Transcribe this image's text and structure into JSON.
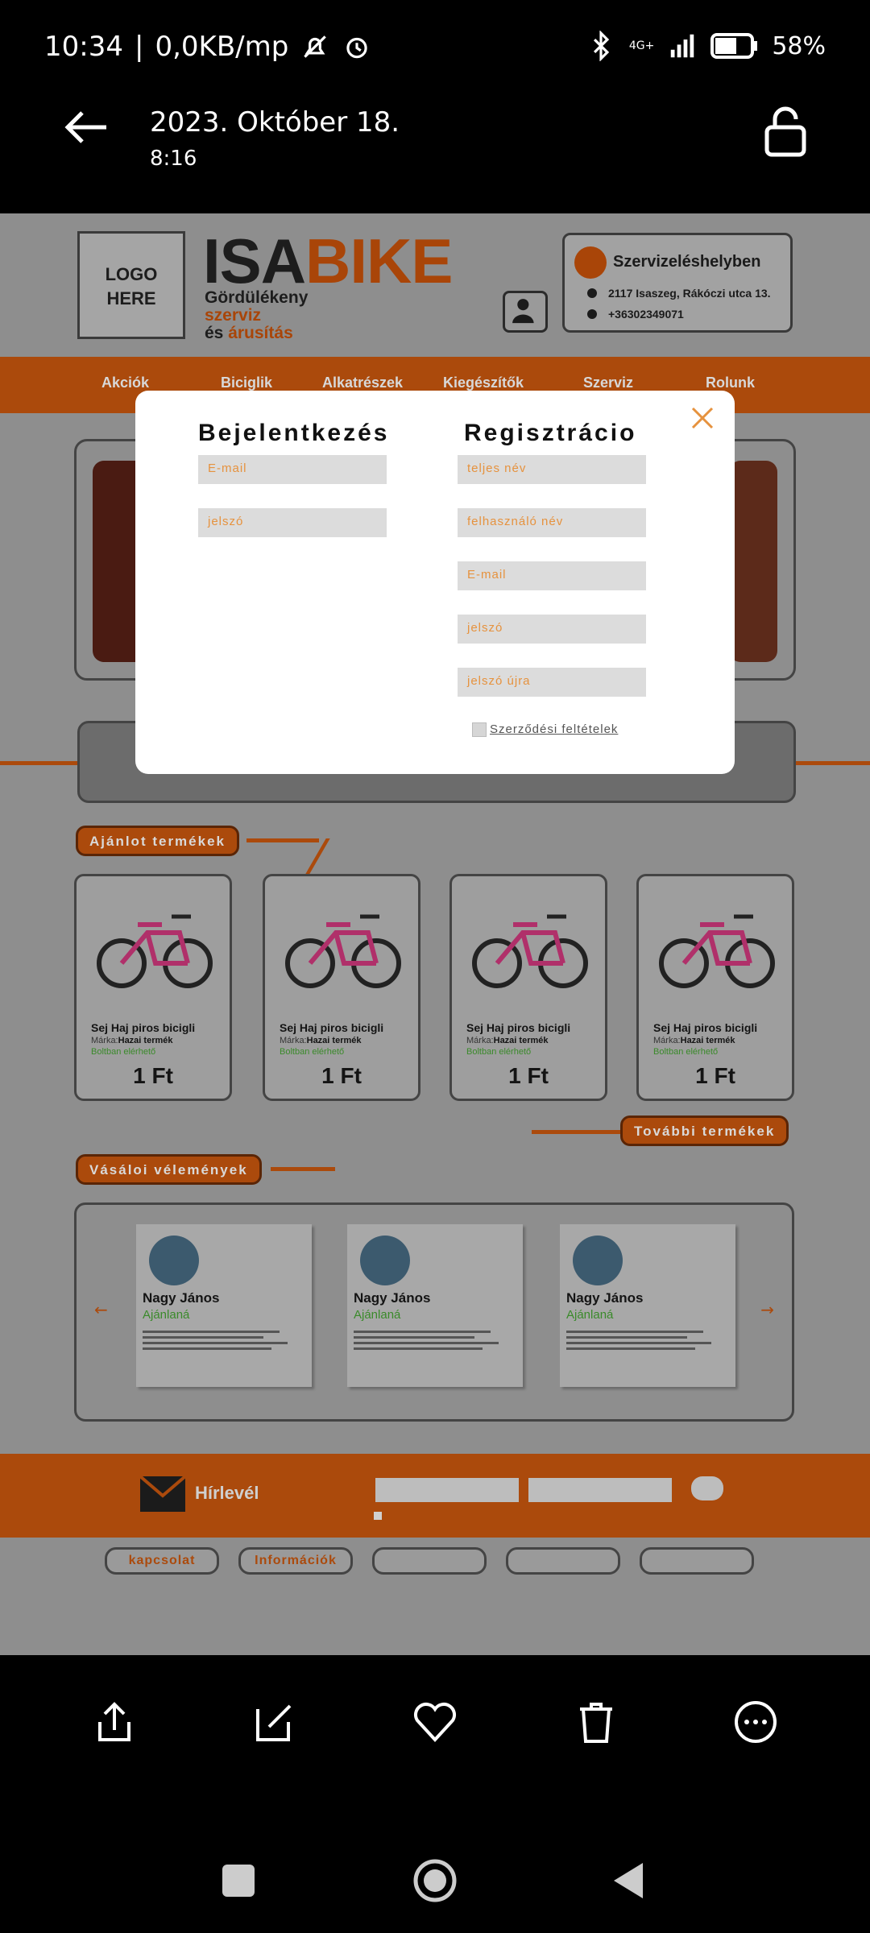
{
  "status_bar": {
    "time": "10:34",
    "network_speed": "0,0KB/mp",
    "network_type": "4G+",
    "battery": "58%"
  },
  "viewer": {
    "date": "2023. Október 18.",
    "time": "8:16"
  },
  "photo": {
    "logo_text_1": "LOGO",
    "logo_text_2": "HERE",
    "brand_dark": "ISA",
    "brand_orange": "BIKE",
    "tagline_1": "Gördülékeny",
    "tagline_2": "szerviz",
    "tagline_3_prefix": "és ",
    "tagline_3_suffix": "árusítás",
    "service_title": "Szervizeléshelyben",
    "service_address": "2117 Isaszeg, Rákóczi utca 13.",
    "service_phone": "+36302349071",
    "nav_items": [
      "Akciók",
      "Biciglik",
      "Alkatrészek",
      "Kiegészítők",
      "Szerviz",
      "Rolunk"
    ],
    "featured_label": "Ajánlot termékek",
    "more_label": "További termékek",
    "reviews_label": "Vásáloi vélemények",
    "products": [
      {
        "name": "Sej Haj piros bicigli",
        "brand_prefix": "Márka:",
        "brand": "Hazai termék",
        "stock": "Boltban elérhető",
        "price": "1 Ft"
      },
      {
        "name": "Sej Haj piros bicigli",
        "brand_prefix": "Márka:",
        "brand": "Hazai termék",
        "stock": "Boltban elérhető",
        "price": "1 Ft"
      },
      {
        "name": "Sej Haj piros bicigli",
        "brand_prefix": "Márka:",
        "brand": "Hazai termék",
        "stock": "Boltban elérhető",
        "price": "1 Ft"
      },
      {
        "name": "Sej Haj piros bicigli",
        "brand_prefix": "Márka:",
        "brand": "Hazai termék",
        "stock": "Boltban elérhető",
        "price": "1 Ft"
      }
    ],
    "reviews": [
      {
        "name": "Nagy János",
        "recommend": "Ajánlaná"
      },
      {
        "name": "Nagy János",
        "recommend": "Ajánlaná"
      },
      {
        "name": "Nagy János",
        "recommend": "Ajánlaná"
      }
    ],
    "arrow_left": "←",
    "arrow_right": "→",
    "newsletter": "Hírlevél",
    "footer_buttons": [
      "kapcsolat",
      "Információk",
      "",
      "",
      ""
    ]
  },
  "modal": {
    "login_title": "Bejelentkezés",
    "register_title": "Regisztrácio",
    "login_email_placeholder": "E-mail",
    "login_password_placeholder": "jelszó",
    "reg_fullname_placeholder": "teljes név",
    "reg_username_placeholder": "felhasználó név",
    "reg_email_placeholder": "E-mail",
    "reg_password_placeholder": "jelszó",
    "reg_password_again_placeholder": "jelszó újra",
    "terms_label": "Szerződési feltételek"
  },
  "colors": {
    "brand_orange": "#ab4a0c",
    "placeholder_orange": "#e6923e"
  }
}
